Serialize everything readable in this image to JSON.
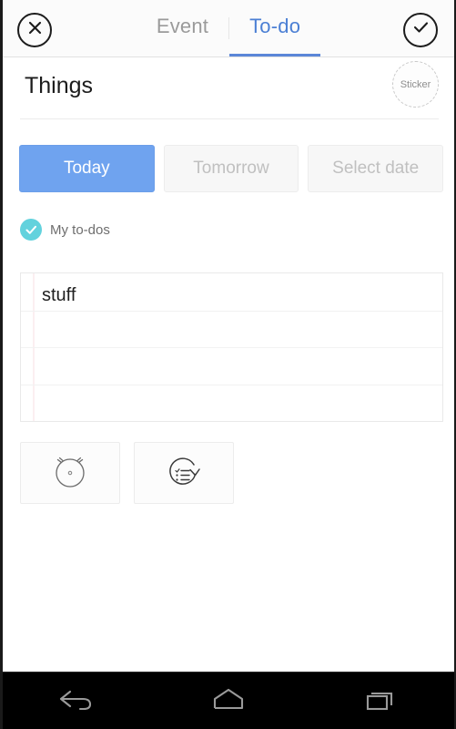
{
  "app": {
    "screen_title": "Things"
  },
  "topbar": {
    "close_icon": "close-circle-icon",
    "done_icon": "check-circle-icon",
    "tabs": [
      {
        "label": "Event",
        "active": false
      },
      {
        "label": "To-do",
        "active": true
      }
    ],
    "active_tab_color": "#5b87d8",
    "inactive_tab_color": "#9a9a9a"
  },
  "title_row": {
    "title": "Things",
    "sticker_label": "Sticker"
  },
  "date_selector": {
    "options": [
      {
        "label": "Today",
        "selected": true
      },
      {
        "label": "Tomorrow",
        "selected": false
      },
      {
        "label": "Select date",
        "selected": false
      }
    ],
    "selected_bg": "#6fa3ef",
    "unselected_bg": "#f7f7f7",
    "unselected_text": "#c0c0c0"
  },
  "list_section": {
    "icon": "check-circle-filled-icon",
    "icon_color": "#62d2dd",
    "label": "My to-dos"
  },
  "notepad": {
    "text": "stuff",
    "line_count": 4,
    "margin_color": "#fbeff1",
    "rule_color": "#f2f2f2"
  },
  "actions": [
    {
      "name": "alarm-clock-icon",
      "label": ""
    },
    {
      "name": "repeat-checklist-icon",
      "label": ""
    }
  ],
  "navbar": {
    "buttons": [
      {
        "name": "back-icon"
      },
      {
        "name": "home-icon"
      },
      {
        "name": "recents-icon"
      }
    ],
    "color": "#9a9a9a"
  }
}
